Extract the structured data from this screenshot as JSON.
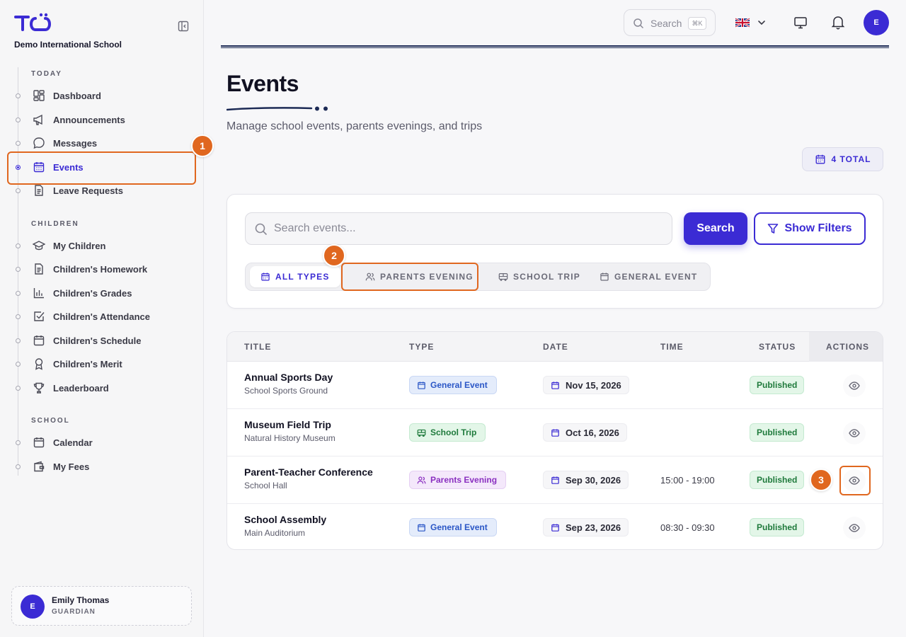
{
  "app": {
    "school_name": "Demo International School"
  },
  "sidebar": {
    "sections": {
      "today": "TODAY",
      "children": "CHILDREN",
      "school": "SCHOOL"
    },
    "items": [
      {
        "label": "Dashboard",
        "icon": "dashboard-icon"
      },
      {
        "label": "Announcements",
        "icon": "megaphone-icon"
      },
      {
        "label": "Messages",
        "icon": "chat-icon"
      },
      {
        "label": "Events",
        "icon": "calendar-icon",
        "active": true
      },
      {
        "label": "Leave Requests",
        "icon": "document-icon"
      },
      {
        "label": "My Children",
        "icon": "graduation-cap-icon"
      },
      {
        "label": "Children's Homework",
        "icon": "document-icon"
      },
      {
        "label": "Children's Grades",
        "icon": "bar-chart-icon"
      },
      {
        "label": "Children's Attendance",
        "icon": "checkbox-icon"
      },
      {
        "label": "Children's Schedule",
        "icon": "calendar-icon"
      },
      {
        "label": "Children's Merit",
        "icon": "award-icon"
      },
      {
        "label": "Leaderboard",
        "icon": "trophy-icon"
      },
      {
        "label": "Calendar",
        "icon": "calendar-icon"
      },
      {
        "label": "My Fees",
        "icon": "wallet-icon"
      }
    ],
    "user": {
      "initial": "E",
      "name": "Emily Thomas",
      "role": "GUARDIAN"
    }
  },
  "topbar": {
    "search_placeholder": "Search",
    "shortcut": "⌘K",
    "language": "en-GB",
    "avatar_initial": "E"
  },
  "header": {
    "title": "Events",
    "subtitle": "Manage school events, parents evenings, and trips",
    "total_badge": "4 TOTAL"
  },
  "search": {
    "placeholder": "Search events...",
    "value": "",
    "search_button": "Search",
    "filters_button": "Show Filters",
    "type_tabs": [
      {
        "label": "ALL TYPES",
        "active": true
      },
      {
        "label": "PARENTS EVENING"
      },
      {
        "label": "SCHOOL TRIP"
      },
      {
        "label": "GENERAL EVENT"
      }
    ]
  },
  "table": {
    "columns": [
      "TITLE",
      "TYPE",
      "DATE",
      "TIME",
      "STATUS",
      "ACTIONS"
    ],
    "rows": [
      {
        "title": "Annual Sports Day",
        "location": "School Sports Ground",
        "type": "General Event",
        "date": "Nov 15, 2026",
        "time": "",
        "status": "Published"
      },
      {
        "title": "Museum Field Trip",
        "location": "Natural History Museum",
        "type": "School Trip",
        "date": "Oct 16, 2026",
        "time": "",
        "status": "Published"
      },
      {
        "title": "Parent-Teacher Conference",
        "location": "School Hall",
        "type": "Parents Evening",
        "date": "Sep 30, 2026",
        "time": "15:00 - 19:00",
        "status": "Published"
      },
      {
        "title": "School Assembly",
        "location": "Main Auditorium",
        "type": "General Event",
        "date": "Sep 23, 2026",
        "time": "08:30 - 09:30",
        "status": "Published"
      }
    ]
  },
  "annotations": [
    "1",
    "2",
    "3"
  ],
  "colors": {
    "accent": "#3b2bd4",
    "highlight": "#e0671f",
    "published": "#1f7a3c"
  }
}
